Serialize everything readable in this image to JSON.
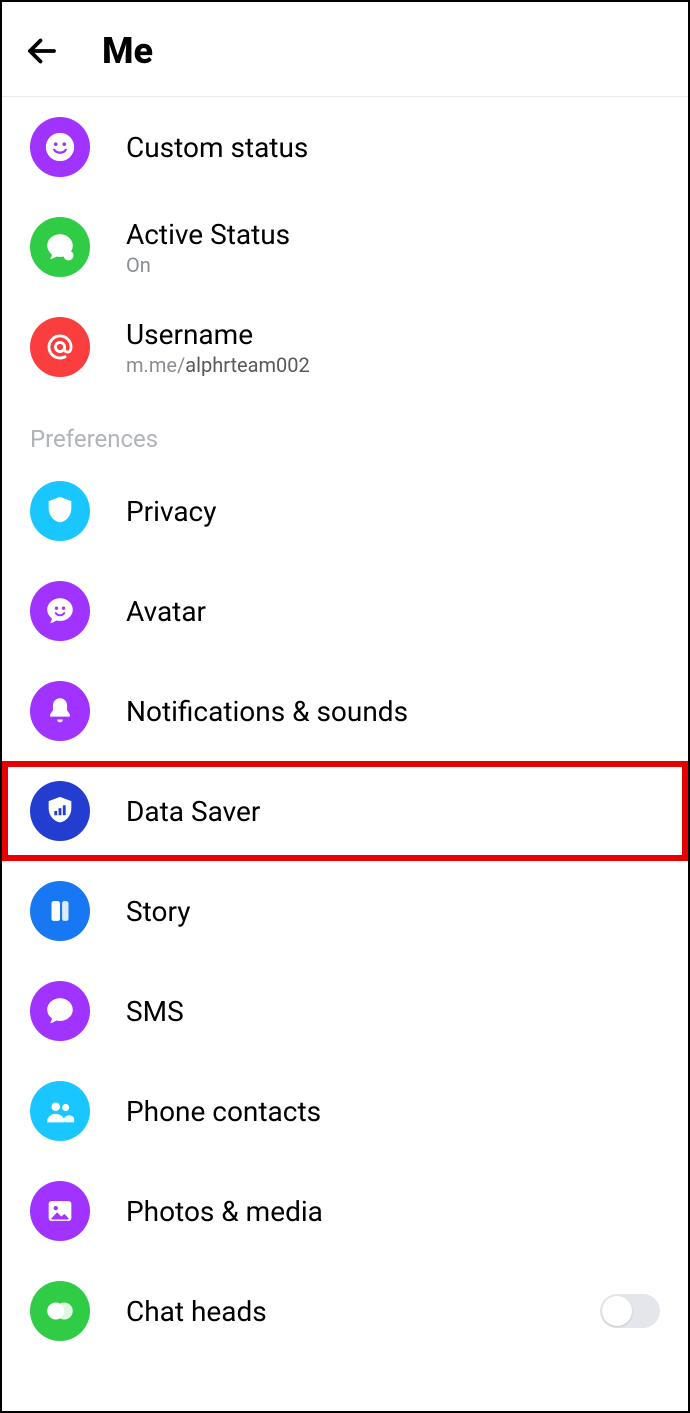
{
  "header": {
    "title": "Me"
  },
  "items": [
    {
      "id": "custom-status",
      "label": "Custom status",
      "sub": null,
      "icon": "smile-icon",
      "color": "bg-purple"
    },
    {
      "id": "active-status",
      "label": "Active Status",
      "sub": "On",
      "icon": "bubble-icon",
      "color": "bg-green"
    },
    {
      "id": "username",
      "label": "Username",
      "subPrefix": "m.me/",
      "subMain": "alphrteam002",
      "icon": "at-icon",
      "color": "bg-red"
    }
  ],
  "section": "Preferences",
  "prefs": [
    {
      "id": "privacy",
      "label": "Privacy",
      "icon": "shield-icon",
      "color": "bg-cyan"
    },
    {
      "id": "avatar",
      "label": "Avatar",
      "icon": "avatar-face-icon",
      "color": "bg-purple"
    },
    {
      "id": "notifications",
      "label": "Notifications & sounds",
      "icon": "bell-icon",
      "color": "bg-purple"
    },
    {
      "id": "data-saver",
      "label": "Data Saver",
      "icon": "shield-bars-icon",
      "color": "bg-indigo",
      "highlight": true
    },
    {
      "id": "story",
      "label": "Story",
      "icon": "story-icon",
      "color": "bg-blue"
    },
    {
      "id": "sms",
      "label": "SMS",
      "icon": "chat-icon",
      "color": "bg-purple"
    },
    {
      "id": "phone-contacts",
      "label": "Phone contacts",
      "icon": "people-icon",
      "color": "bg-cyan"
    },
    {
      "id": "photos-media",
      "label": "Photos & media",
      "icon": "photo-icon",
      "color": "bg-purple"
    },
    {
      "id": "chat-heads",
      "label": "Chat heads",
      "icon": "chatheads-icon",
      "color": "bg-green",
      "toggle": false
    }
  ]
}
